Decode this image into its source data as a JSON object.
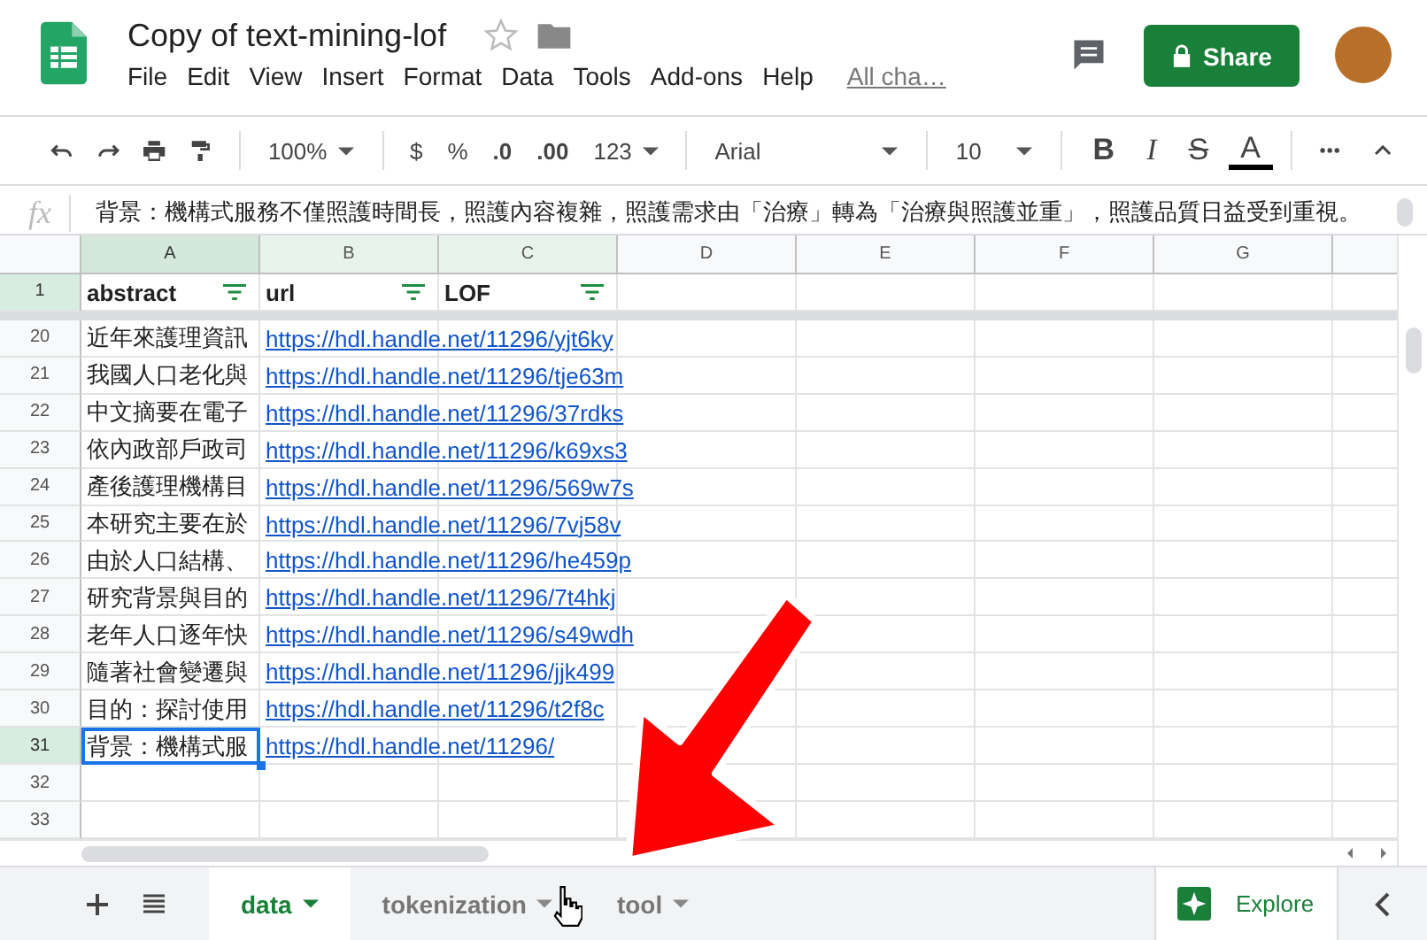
{
  "app": {
    "title": "Copy of text-mining-lof",
    "menu": [
      "File",
      "Edit",
      "View",
      "Insert",
      "Format",
      "Data",
      "Tools",
      "Add-ons",
      "Help"
    ],
    "last_edit": "All cha…",
    "share": "Share"
  },
  "toolbar": {
    "zoom": "100%",
    "currency": "$",
    "percent": "%",
    "decrease_decimals": ".0",
    "increase_decimals": ".00",
    "more_formats": "123",
    "font": "Arial",
    "font_size": "10",
    "bold": "B",
    "italic": "I",
    "strikethrough": "S",
    "text_color": "A"
  },
  "formula_bar": {
    "label": "fx",
    "value": "背景：機構式服務不僅照護時間長，照護內容複雜，照護需求由「治療」轉為「治療與照護並重」，照護品質日益受到重視。"
  },
  "sheet": {
    "columns": [
      {
        "label": "A",
        "selected": true
      },
      {
        "label": "B",
        "selected": false
      },
      {
        "label": "C",
        "selected": false
      },
      {
        "label": "D",
        "selected": false
      },
      {
        "label": "E",
        "selected": false
      },
      {
        "label": "F",
        "selected": false
      },
      {
        "label": "G",
        "selected": false
      }
    ],
    "header_row": {
      "number": "1",
      "cells": [
        "abstract",
        "url",
        "LOF"
      ]
    },
    "rows": [
      {
        "number": "20",
        "abstract": "近年來護理資訊",
        "url": "https://hdl.handle.net/11296/yjt6ky",
        "selected": false
      },
      {
        "number": "21",
        "abstract": "我國人口老化與",
        "url": "https://hdl.handle.net/11296/tje63m",
        "selected": false
      },
      {
        "number": "22",
        "abstract": "中文摘要在電子",
        "url": "https://hdl.handle.net/11296/37rdks",
        "selected": false
      },
      {
        "number": "23",
        "abstract": "依內政部戶政司",
        "url": "https://hdl.handle.net/11296/k69xs3",
        "selected": false
      },
      {
        "number": "24",
        "abstract": "產後護理機構目",
        "url": "https://hdl.handle.net/11296/569w7s",
        "selected": false
      },
      {
        "number": "25",
        "abstract": "本研究主要在於",
        "url": "https://hdl.handle.net/11296/7vj58v",
        "selected": false
      },
      {
        "number": "26",
        "abstract": "由於人口結構、",
        "url": "https://hdl.handle.net/11296/he459p",
        "selected": false
      },
      {
        "number": "27",
        "abstract": "研究背景與目的",
        "url": "https://hdl.handle.net/11296/7t4hkj",
        "selected": false
      },
      {
        "number": "28",
        "abstract": "老年人口逐年快",
        "url": "https://hdl.handle.net/11296/s49wdh",
        "selected": false
      },
      {
        "number": "29",
        "abstract": "隨著社會變遷與",
        "url": "https://hdl.handle.net/11296/jjk499",
        "selected": false
      },
      {
        "number": "30",
        "abstract": "目的：探討使用",
        "url": "https://hdl.handle.net/11296/t2f8c",
        "selected": false
      },
      {
        "number": "31",
        "abstract": "背景：機構式服",
        "url": "https://hdl.handle.net/11296/",
        "selected": true
      },
      {
        "number": "32",
        "selected": false
      },
      {
        "number": "33",
        "selected": false
      }
    ]
  },
  "tabs": [
    {
      "label": "data",
      "selected": true
    },
    {
      "label": "tokenization",
      "selected": false
    },
    {
      "label": "tool",
      "selected": false
    }
  ],
  "explore": "Explore"
}
